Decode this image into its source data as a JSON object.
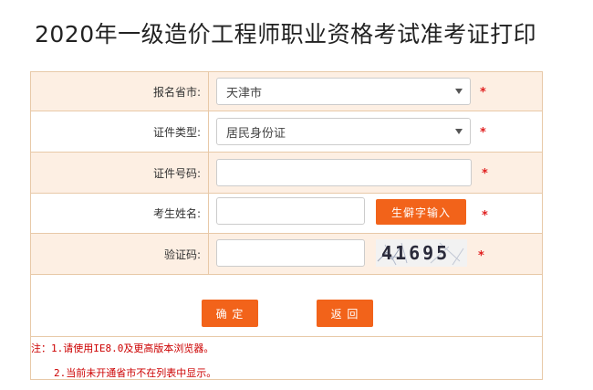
{
  "page": {
    "title": "2020年一级造价工程师职业资格考试准考证打印"
  },
  "form": {
    "province": {
      "label": "报名省市:",
      "value": "天津市"
    },
    "id_type": {
      "label": "证件类型:",
      "value": "居民身份证"
    },
    "id_number": {
      "label": "证件号码:",
      "value": ""
    },
    "name": {
      "label": "考生姓名:",
      "value": "",
      "rare_char_button": "生僻字输入"
    },
    "captcha": {
      "label": "验证码:",
      "value": "",
      "image_text": "41695"
    },
    "required_mark": "*"
  },
  "buttons": {
    "confirm": "确 定",
    "back": "返 回"
  },
  "notes": {
    "line1": "注：1.请使用IE8.0及更高版本浏览器。",
    "line2": "2.当前未开通省市不在列表中显示。"
  },
  "colors": {
    "accent": "#f2631a",
    "row_shade": "#fdefe3",
    "border": "#e8c9a8",
    "required": "#e02020"
  }
}
